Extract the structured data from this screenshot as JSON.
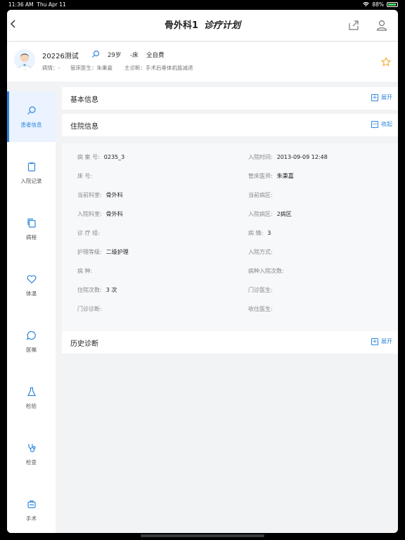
{
  "status_bar": {
    "time": "11:36 AM",
    "date": "Thu Apr 11",
    "battery": "88%"
  },
  "navbar": {
    "department": "骨外科1",
    "title": "诊疗计划"
  },
  "patient": {
    "name": "20226测试",
    "age": "29岁",
    "bed": "-床",
    "fee_type": "全自费",
    "condition_label": "病情：",
    "condition_value": "-",
    "doctor_label": "管床医生：",
    "doctor_value": "朱秉嘉",
    "diagnosis_label": "主诊断：",
    "diagnosis_value": "手术后垂体机能减退"
  },
  "sidebar": {
    "items": [
      {
        "label": "患者信息",
        "icon": "search-icon"
      },
      {
        "label": "入院记录",
        "icon": "clipboard-icon"
      },
      {
        "label": "病程",
        "icon": "copy-icon"
      },
      {
        "label": "体温",
        "icon": "heart-icon"
      },
      {
        "label": "医嘱",
        "icon": "chat-icon"
      },
      {
        "label": "检验",
        "icon": "flask-icon"
      },
      {
        "label": "检查",
        "icon": "stethoscope-icon"
      },
      {
        "label": "手术",
        "icon": "bag-icon"
      }
    ]
  },
  "panels": {
    "basic": {
      "title": "基本信息",
      "action": "展开"
    },
    "inpatient": {
      "title": "住院信息",
      "action": "收起"
    },
    "history": {
      "title": "历史诊断",
      "action": "展开"
    }
  },
  "inpatient_fields": {
    "left": [
      {
        "label": "病 案 号:",
        "value": "0235_3"
      },
      {
        "label": "床 号:",
        "value": ""
      },
      {
        "label": "当前科室:",
        "value": "骨外科"
      },
      {
        "label": "入院科室:",
        "value": "骨外科"
      },
      {
        "label": "诊 疗 组:",
        "value": ""
      },
      {
        "label": "护理等级:",
        "value": "二级护理"
      },
      {
        "label": "病 种:",
        "value": ""
      },
      {
        "label": "住院次数:",
        "value": "3 次"
      },
      {
        "label": "门诊诊断:",
        "value": ""
      }
    ],
    "right": [
      {
        "label": "入院时间:",
        "value": "2013-09-09 12:48"
      },
      {
        "label": "管床医师:",
        "value": "朱秉嘉"
      },
      {
        "label": "当前病区:",
        "value": ""
      },
      {
        "label": "入院病区:",
        "value": "2病区"
      },
      {
        "label": "病 情:",
        "value": "3"
      },
      {
        "label": "入院方式:",
        "value": ""
      },
      {
        "label": "病种入院次数:",
        "value": ""
      },
      {
        "label": "门诊医生:",
        "value": ""
      },
      {
        "label": "收住医生:",
        "value": ""
      }
    ]
  },
  "colors": {
    "accent": "#2e86de",
    "background": "#f2f3f5",
    "star": "#f5a623"
  }
}
